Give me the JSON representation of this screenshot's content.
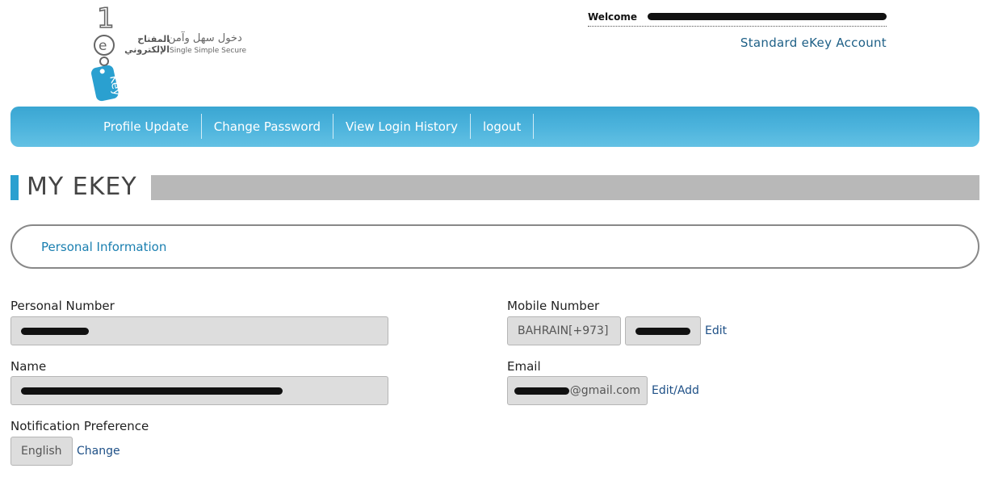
{
  "header": {
    "logo": {
      "brand_ar": "المفتاح الإلكتروني",
      "tagline_ar": "دخول سهل وآمن",
      "tagline_en": "Single Simple Secure",
      "key_text": "Key",
      "key_number": "1",
      "key_letter": "e"
    },
    "welcome_label": "Welcome",
    "account_type": "Standard eKey Account"
  },
  "nav": {
    "items": [
      {
        "label": "Profile Update"
      },
      {
        "label": "Change Password"
      },
      {
        "label": "View Login History"
      },
      {
        "label": "logout"
      }
    ]
  },
  "page": {
    "title": "MY EKEY",
    "tab_label": "Personal Information"
  },
  "form": {
    "personal_number": {
      "label": "Personal Number"
    },
    "name": {
      "label": "Name"
    },
    "notification": {
      "label": "Notification Preference",
      "value": "English",
      "change_label": "Change"
    },
    "mobile": {
      "label": "Mobile Number",
      "country": "BAHRAIN[+973]",
      "edit_label": "Edit"
    },
    "email": {
      "label": "Email",
      "domain": "@gmail.com",
      "edit_label": "Edit/Add"
    }
  },
  "colors": {
    "nav_blue": "#4cb3dc",
    "accent": "#2aa0d0",
    "link": "#1d4f86"
  }
}
